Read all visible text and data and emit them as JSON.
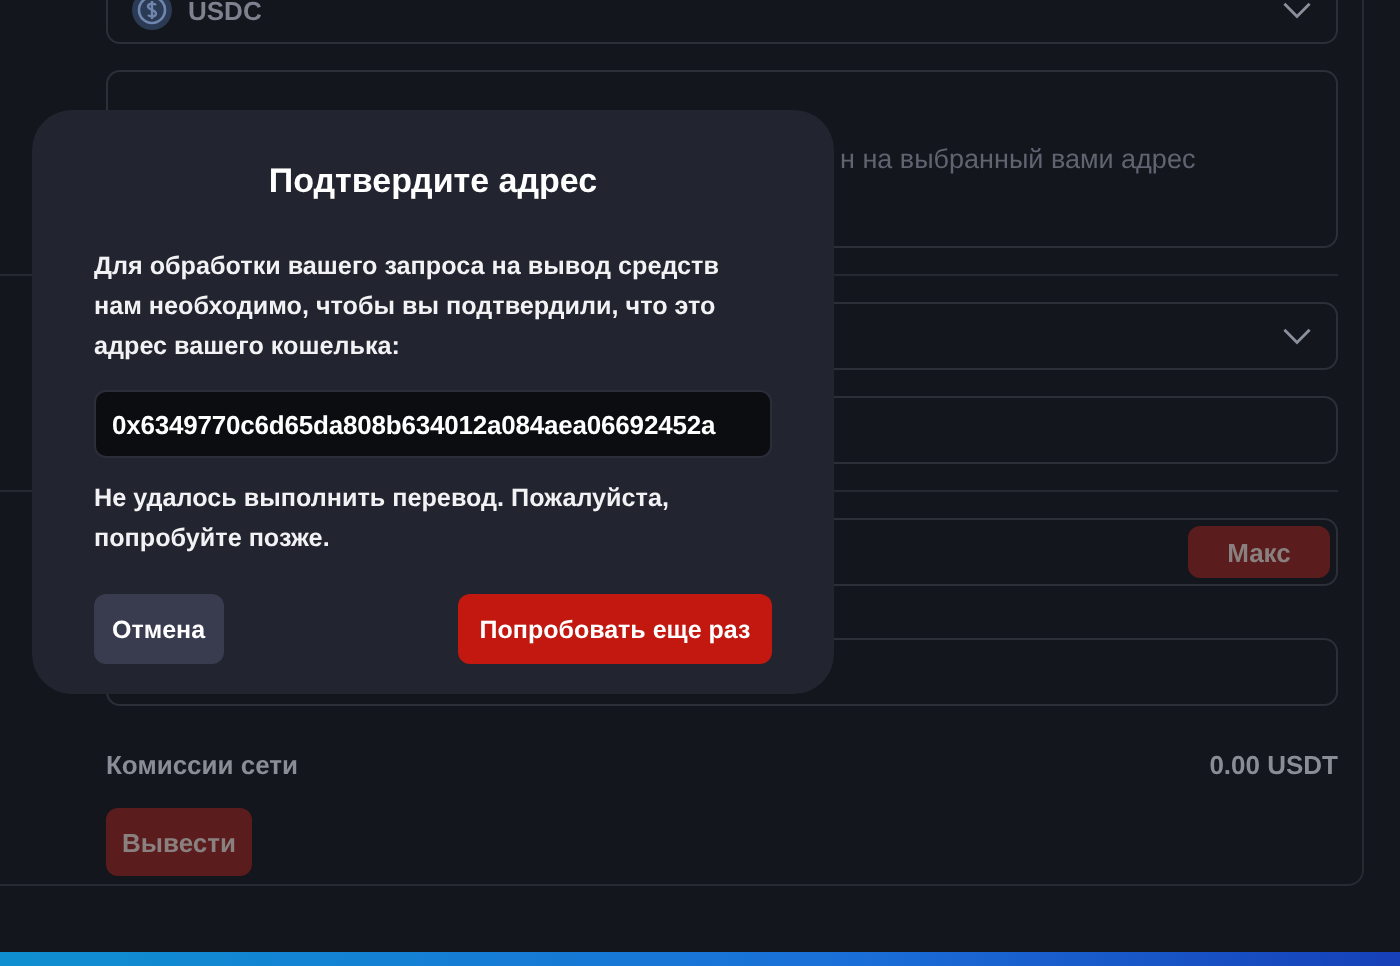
{
  "form": {
    "token_select": {
      "value": "USDC"
    },
    "note": {
      "text": "н на выбранный вами адрес"
    },
    "max_button": {
      "label": "Макс",
      "disabled": true
    },
    "fee": {
      "label": "Комиссии сети",
      "value": "0.00 USDT"
    },
    "submit_button": {
      "label": "Вывести",
      "disabled": true
    }
  },
  "dialog": {
    "title": "Подтвердите адрес",
    "message": "Для обработки вашего запроса на вывод средств нам необходимо, чтобы вы подтвердили, что это адрес вашего кошелька:",
    "address": "0x6349770c6d65da808b634012a084aea06692452a",
    "error": "Не удалось выполнить перевод. Пожалуйста, попробуйте позже.",
    "buttons": [
      {
        "label": "Отмена",
        "kind": "secondary"
      },
      {
        "label": "Попробовать еще раз",
        "kind": "primary"
      }
    ]
  }
}
